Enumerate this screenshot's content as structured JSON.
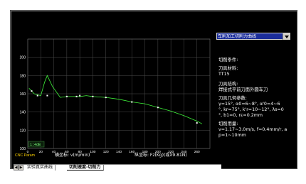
{
  "side": {
    "dropdown_value": "车削加工切削力曲线",
    "cutting_conditions_title": "切削条件:",
    "tool_material_label": "刀具材料:",
    "tool_material_value": "TT15",
    "tool_structure_label": "刀具结构:",
    "tool_structure_value": "焊接式平前刀面外圆车刀",
    "tool_geometry_label": "刀具几何参数:",
    "tool_geometry_line1": "γ=15°, α0=6~8°, α'0=4~6",
    "tool_geometry_line2": "°, kr=75°, k'r=10~12°, λs=0",
    "tool_geometry_line3": "°, b1=0, rε=0.2mm",
    "cutting_params_label": "切削用量:",
    "cutting_params_line1": "v=1.17~3.0m/s, f=0.4mm/r, a",
    "cutting_params_line2": "p=1~10mm"
  },
  "plot_overlay": {
    "readout": "1:4dB",
    "brand": "CNC Param",
    "x_axis_title": "横坐标: v(m/min)",
    "y_axis_title": "纵坐标: Fz(Kg)(或X9.81N)"
  },
  "tabs": [
    {
      "label": "实验真实曲线",
      "active": false
    },
    {
      "label": "切削速度-切削力",
      "active": true
    }
  ],
  "chart_data": {
    "type": "line",
    "title": "",
    "xlabel": "横坐标: v(m/min)",
    "ylabel": "纵坐标: Fz(Kg)(或X9.81N)",
    "xlim": [
      0,
      280
    ],
    "ylim": [
      100,
      220
    ],
    "x_ticks": [
      "0",
      "20",
      "40",
      "60",
      "80",
      "100",
      "120",
      "140",
      "160",
      "180",
      "200",
      "220",
      "240",
      "260"
    ],
    "y_ticks": [
      "100",
      "120",
      "140",
      "160",
      "180",
      "200"
    ],
    "grid": true,
    "series": [
      {
        "color": "#3ff23a",
        "x": [
          2,
          10,
          20,
          26,
          30,
          38,
          50,
          60,
          70,
          80,
          90,
          100,
          120,
          140,
          160,
          180,
          200,
          220,
          240,
          260,
          268
        ],
        "y": [
          166,
          160,
          158,
          173,
          180,
          168,
          156,
          157,
          157,
          157,
          158,
          157,
          156,
          154,
          151,
          149,
          145,
          141,
          136,
          130,
          127
        ]
      }
    ],
    "markers": {
      "x": [
        6,
        15,
        30,
        60,
        75,
        80,
        100,
        120,
        160,
        200,
        260
      ],
      "y": [
        163,
        158,
        158,
        157,
        157,
        158,
        157,
        156,
        151,
        145,
        128
      ]
    },
    "colors": {
      "background": "#000000",
      "grid": "#4d4d4d",
      "axis_text": "#ffffff",
      "brand": "#ffd200",
      "readout_text": "#7dff7d"
    }
  }
}
